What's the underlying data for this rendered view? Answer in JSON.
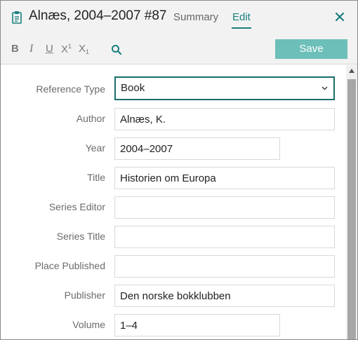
{
  "header": {
    "title": "Alnæs, 2004–2007 #87",
    "tabs": [
      {
        "label": "Summary",
        "active": false
      },
      {
        "label": "Edit",
        "active": true
      }
    ]
  },
  "toolbar": {
    "bold": "B",
    "italic": "I",
    "underline": "U",
    "superscript_base": "X",
    "superscript_mark": "1",
    "subscript_base": "X",
    "subscript_mark": "1",
    "save_label": "Save"
  },
  "form": {
    "fields": [
      {
        "label": "Reference Type",
        "value": "Book"
      },
      {
        "label": "Author",
        "value": "Alnæs, K."
      },
      {
        "label": "Year",
        "value": "2004–2007"
      },
      {
        "label": "Title",
        "value": "Historien om Europa"
      },
      {
        "label": "Series Editor",
        "value": ""
      },
      {
        "label": "Series Title",
        "value": ""
      },
      {
        "label": "Place Published",
        "value": ""
      },
      {
        "label": "Publisher",
        "value": "Den norske bokklubben"
      },
      {
        "label": "Volume",
        "value": "1–4"
      }
    ]
  },
  "colors": {
    "accent": "#1a7f7f",
    "save_button": "#6dbfba",
    "header_bg": "#f2f2f2",
    "scroll_thumb": "#a6a6a6"
  },
  "icons": [
    "clipboard-icon",
    "close-icon",
    "search-icon",
    "chevron-down-icon",
    "scroll-up-arrow-icon"
  ]
}
